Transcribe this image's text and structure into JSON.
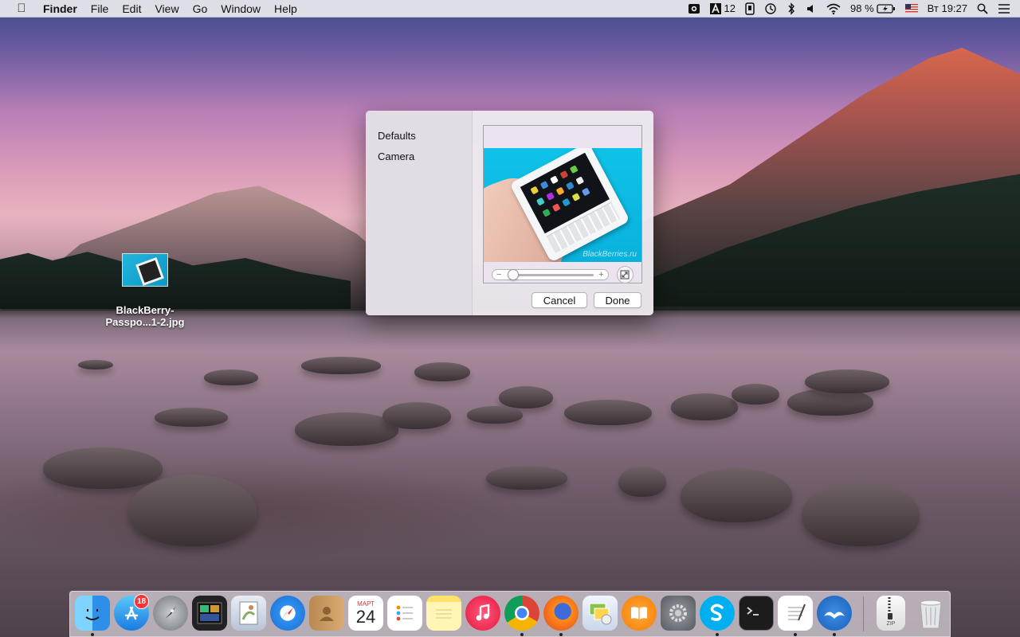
{
  "menubar": {
    "app_name": "Finder",
    "menus": [
      "File",
      "Edit",
      "View",
      "Go",
      "Window",
      "Help"
    ],
    "status": {
      "font_size_value": "12",
      "battery_percent": "98 %",
      "clock": "Вт 19:27"
    }
  },
  "desktop": {
    "file_icon_label": "BlackBerry-Passpo...1-2.jpg"
  },
  "dialog": {
    "sidebar_items": [
      "Defaults",
      "Camera"
    ],
    "preview_watermark": "BlackBerries.ru",
    "zoom_minus": "−",
    "zoom_plus": "+",
    "cancel_label": "Cancel",
    "done_label": "Done"
  },
  "dock": {
    "badge_count": "18",
    "calendar_month": "МАРТ",
    "calendar_day": "24",
    "zip_label": "ZIP"
  },
  "colors": {
    "menubar_bg": "#ECEAEE",
    "dialog_bg": "#ECE8EE",
    "badge_red": "#FF3333",
    "preview_cyan": "#10C2E8"
  }
}
